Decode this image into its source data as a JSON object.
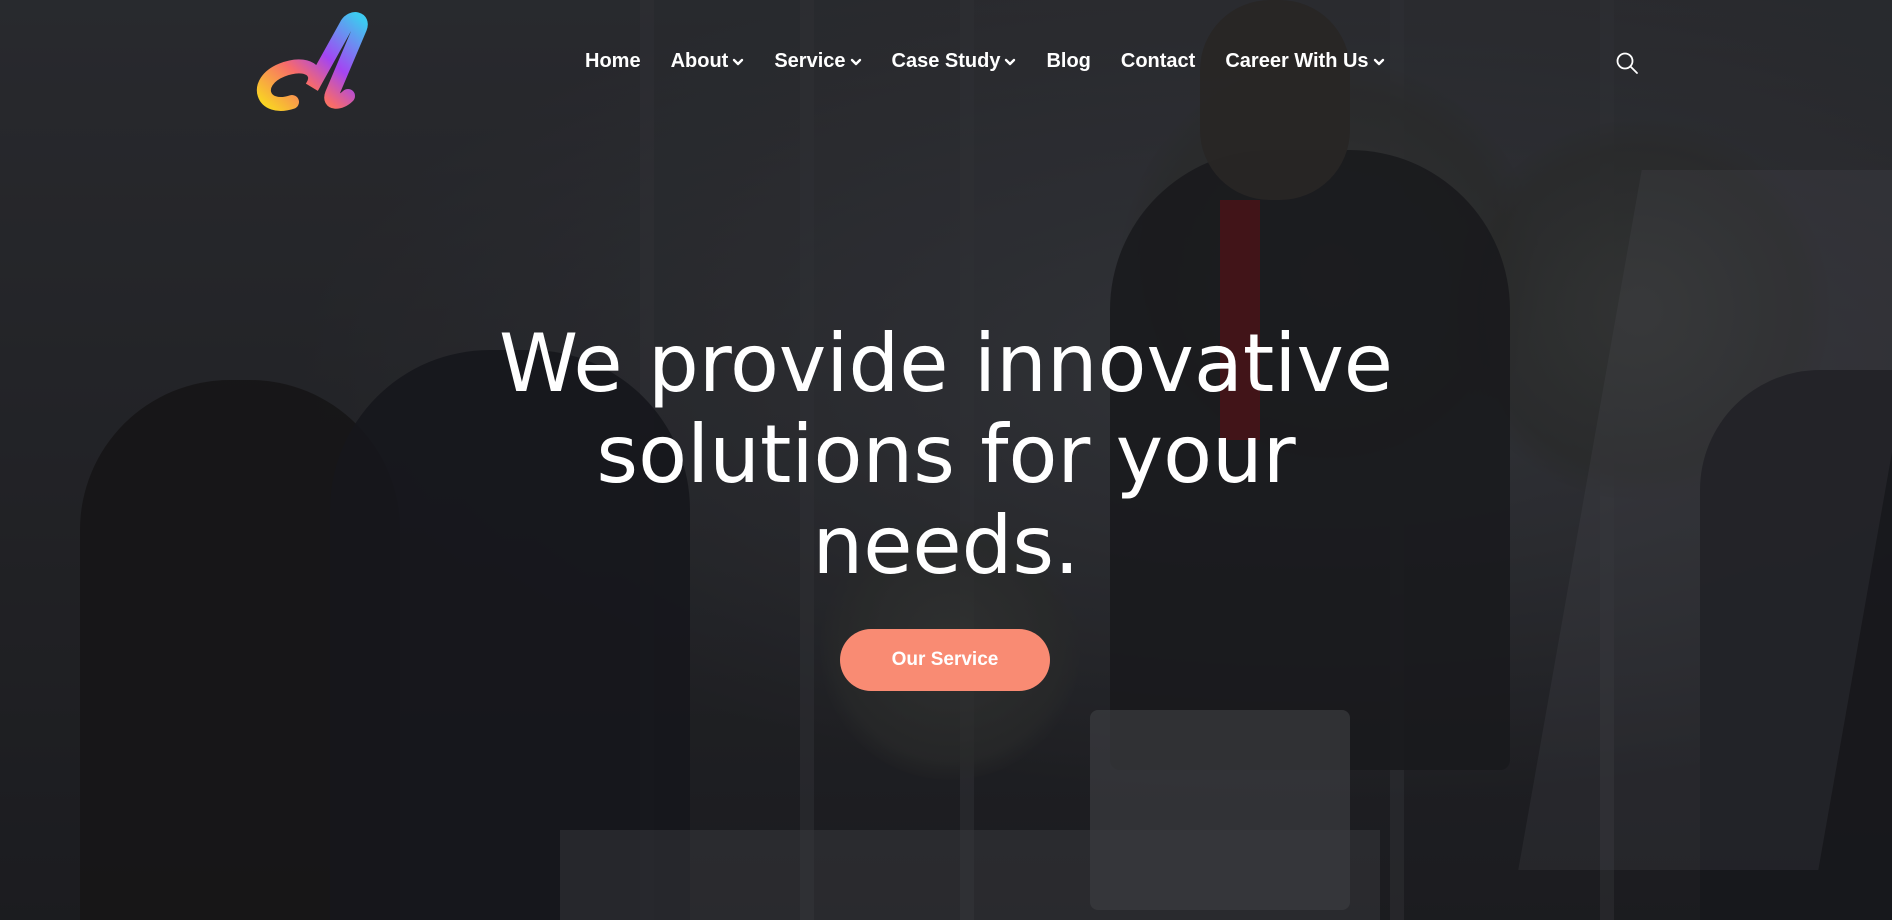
{
  "brand": {
    "logo_icon": "brand-a-logo",
    "gradient_colors": [
      "#f9d423",
      "#a445f2",
      "#3ec9f0",
      "#ff5e7e"
    ]
  },
  "nav": {
    "items": [
      {
        "label": "Home",
        "dropdown": false
      },
      {
        "label": "About",
        "dropdown": true
      },
      {
        "label": "Service",
        "dropdown": true
      },
      {
        "label": "Case Study",
        "dropdown": true
      },
      {
        "label": "Blog",
        "dropdown": false
      },
      {
        "label": "Contact",
        "dropdown": false
      },
      {
        "label": "Career With Us",
        "dropdown": true
      }
    ],
    "search_icon": "search-icon"
  },
  "hero": {
    "title": "We provide innovative solutions for your needs.",
    "cta_label": "Our Service",
    "cta_color": "#f98b73",
    "overlay_color": "#141418"
  }
}
